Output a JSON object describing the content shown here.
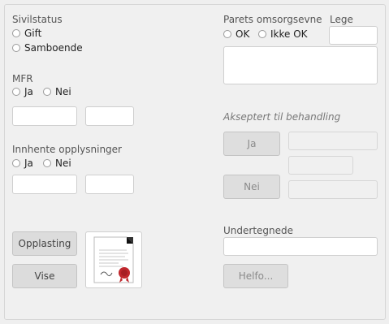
{
  "left": {
    "sivilstatus": {
      "label": "Sivilstatus",
      "options": [
        "Gift",
        "Samboende"
      ]
    },
    "mfr": {
      "label": "MFR",
      "options": [
        "Ja",
        "Nei"
      ]
    },
    "innhente": {
      "label": "Innhente opplysninger",
      "options": [
        "Ja",
        "Nei"
      ]
    },
    "buttons": {
      "upload": "Opplasting",
      "view": "Vise"
    }
  },
  "right": {
    "omsorg": {
      "label": "Parets omsorgsevne",
      "options": [
        "OK",
        "Ikke OK"
      ]
    },
    "lege": {
      "label": "Lege"
    },
    "akseptert": {
      "label": "Akseptert til behandling",
      "ja": "Ja",
      "nei": "Nei"
    },
    "undertegnede": {
      "label": "Undertegnede"
    },
    "helfo": "Helfo..."
  },
  "icons": {
    "document": "document-with-seal-icon"
  }
}
